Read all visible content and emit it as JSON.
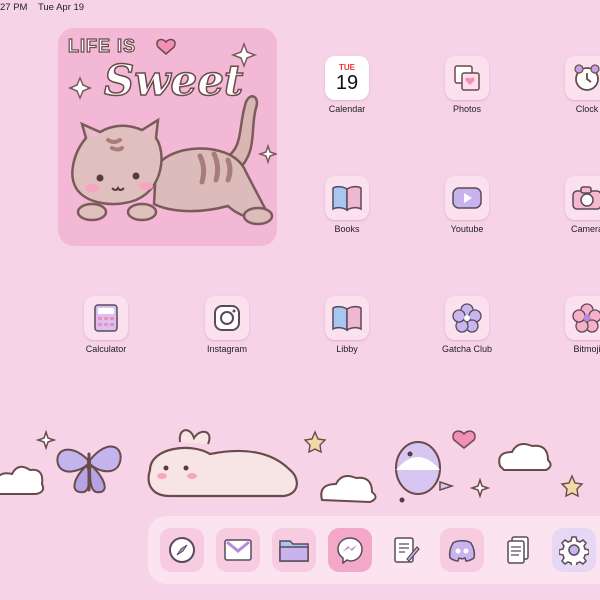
{
  "status": {
    "time": "27 PM",
    "date": "Tue Apr 19"
  },
  "widget": {
    "line1": "LIFE IS",
    "line2": "Sweet"
  },
  "apps": [
    {
      "label": "Calendar",
      "icon": "calendar-icon"
    },
    {
      "label": "Photos",
      "icon": "photos-icon"
    },
    {
      "label": "Clock",
      "icon": "clock-icon"
    },
    {
      "label": "Books",
      "icon": "books-icon"
    },
    {
      "label": "Youtube",
      "icon": "youtube-icon"
    },
    {
      "label": "Camera",
      "icon": "camera-icon"
    },
    {
      "label": "Calculator",
      "icon": "calculator-icon"
    },
    {
      "label": "Instagram",
      "icon": "instagram-icon"
    },
    {
      "label": "Libby",
      "icon": "libby-icon"
    },
    {
      "label": "Gatcha Club",
      "icon": "flower-icon"
    },
    {
      "label": "Bitmoji",
      "icon": "bitmoji-icon"
    }
  ],
  "calendar": {
    "weekday": "TUE",
    "day": "19"
  },
  "dock": [
    {
      "icon": "safari-icon"
    },
    {
      "icon": "gmail-icon"
    },
    {
      "icon": "files-icon"
    },
    {
      "icon": "messenger-icon"
    },
    {
      "icon": "pages-icon"
    },
    {
      "icon": "discord-icon"
    },
    {
      "icon": "documents-icon"
    },
    {
      "icon": "settings-icon"
    }
  ],
  "colors": {
    "background": "#f6d3e6",
    "widget": "#f3b8d6",
    "accent": "#b58cd9"
  }
}
